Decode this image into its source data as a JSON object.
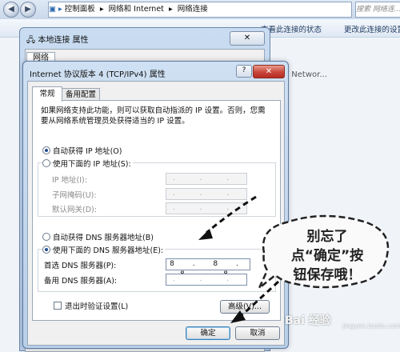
{
  "explorer": {
    "address_segments": [
      "控制面板",
      "网络和 Internet",
      "网络连接"
    ],
    "separator": "▸",
    "search_placeholder": "搜索 网络连...",
    "commands": [
      "查看此连接的状态",
      "更改此连接的设置"
    ],
    "adapter_label": "T Networ..."
  },
  "back_dialog": {
    "title": "本地连接 属性",
    "tab": "网络",
    "close_glyph": "✕"
  },
  "dialog": {
    "title": "Internet 协议版本 4 (TCP/IPv4) 属性",
    "help_glyph": "?",
    "close_glyph": "✕",
    "tabs": [
      "常规",
      "备用配置"
    ],
    "description": "如果网络支持此功能，则可以获取自动指派的 IP 设置。否则，您需要从网络系统管理员处获得适当的 IP 设置。",
    "ip_options": {
      "auto": "自动获得 IP 地址(O)",
      "manual": "使用下面的 IP 地址(S):",
      "fields": [
        {
          "label": "IP 地址(I):",
          "value": ". . ."
        },
        {
          "label": "子网掩码(U):",
          "value": ". . ."
        },
        {
          "label": "默认网关(D):",
          "value": ". . ."
        }
      ]
    },
    "dns_options": {
      "auto": "自动获得 DNS 服务器地址(B)",
      "manual": "使用下面的 DNS 服务器地址(E):",
      "fields": [
        {
          "label": "首选 DNS 服务器(P):",
          "value": "8 . 8 . 8 . 8"
        },
        {
          "label": "备用 DNS 服务器(A):",
          "value": ". . ."
        }
      ]
    },
    "validate_label": "退出时验证设置(L)",
    "advanced_label": "高级(V)...",
    "ok_label": "确定",
    "cancel_label": "取消"
  },
  "annotation": {
    "lines": [
      "别忘了",
      "点“确定”按",
      "钮保存哦！"
    ]
  },
  "watermark": {
    "text": "Bai 经验",
    "sub": "jingyan.baidu.com"
  }
}
